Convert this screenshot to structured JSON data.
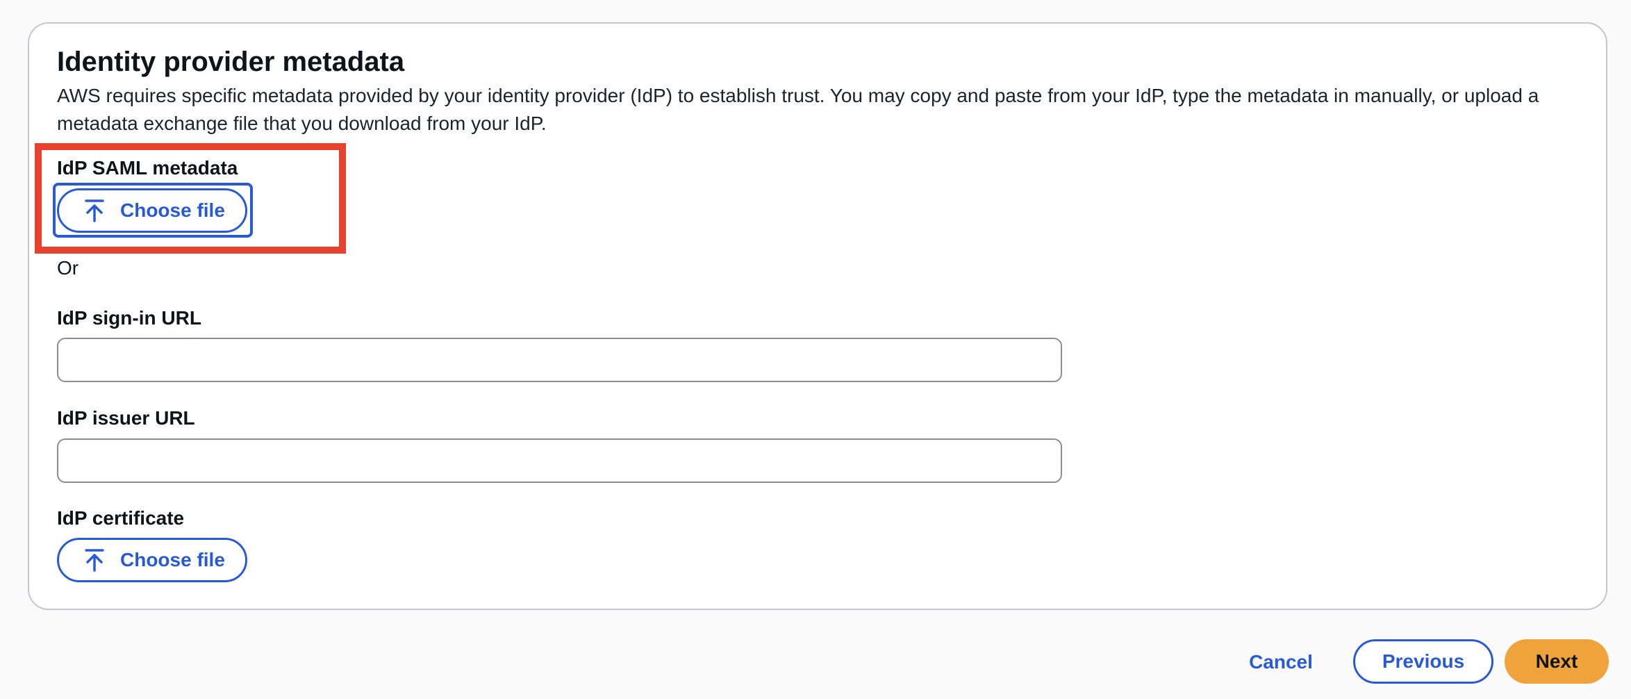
{
  "section": {
    "title": "Identity provider metadata",
    "description": "AWS requires specific metadata provided by your identity provider (IdP) to establish trust. You may copy and paste from your IdP, type the metadata in manually, or upload a metadata exchange file that you download from your IdP."
  },
  "saml_metadata": {
    "label": "IdP SAML metadata",
    "button_label": "Choose file",
    "icon": "upload-arrow-icon"
  },
  "separator": {
    "text": "Or"
  },
  "signin_url": {
    "label": "IdP sign-in URL",
    "value": "",
    "placeholder": ""
  },
  "issuer_url": {
    "label": "IdP issuer URL",
    "value": "",
    "placeholder": ""
  },
  "certificate": {
    "label": "IdP certificate",
    "button_label": "Choose file",
    "icon": "upload-arrow-icon"
  },
  "footer": {
    "cancel_label": "Cancel",
    "previous_label": "Previous",
    "next_label": "Next"
  },
  "colors": {
    "accent": "#295ad6",
    "primary_button": "#f0a33a",
    "highlight": "#e8412d",
    "border": "#c6c6cd"
  }
}
